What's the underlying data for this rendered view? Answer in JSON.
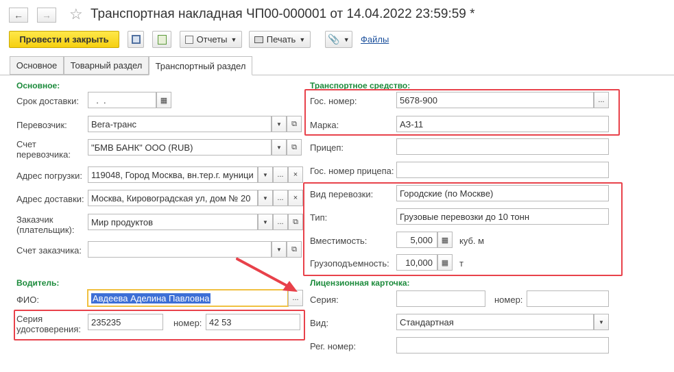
{
  "header": {
    "title": "Транспортная накладная ЧП00-000001 от 14.04.2022 23:59:59 *"
  },
  "toolbar": {
    "post_close": "Провести и закрыть",
    "reports": "Отчеты",
    "print": "Печать",
    "files": "Файлы"
  },
  "tabs": [
    "Основное",
    "Товарный раздел",
    "Транспортный раздел"
  ],
  "left": {
    "section_main": "Основное:",
    "delivery_label": "Срок доставки:",
    "delivery_value": "  .  .",
    "carrier_label": "Перевозчик:",
    "carrier_value": "Вега-транс",
    "carrier_acc_label": "Счет перевозчика:",
    "carrier_acc_value": "\"БМВ БАНК\" ООО (RUB)",
    "load_label": "Адрес погрузки:",
    "load_value": "119048, Город Москва, вн.тер.г. муници",
    "deliv_addr_label": "Адрес доставки:",
    "deliv_addr_value": "Москва, Кировоградская ул, дом № 20",
    "customer_label": "Заказчик (плательщик):",
    "customer_value": "Мир продуктов",
    "customer_acc_label": "Счет заказчика:",
    "customer_acc_value": "",
    "section_driver": "Водитель:",
    "fio_label": "ФИО:",
    "fio_value": "Авдеева Аделина Павловна",
    "series_label": "Серия удостоверения:",
    "series_value": "235235",
    "number_label": "номер:",
    "number_value": "42 53"
  },
  "right": {
    "section_vehicle": "Транспортное средство:",
    "plate_label": "Гос. номер:",
    "plate_value": "5678-900",
    "brand_label": "Марка:",
    "brand_value": "АЗ-11",
    "trailer_label": "Прицеп:",
    "trailer_value": "",
    "trailer_plate_label": "Гос. номер прицепа:",
    "trailer_plate_value": "",
    "transport_kind_label": "Вид перевозки:",
    "transport_kind_value": "Городские (по Москве)",
    "type_label": "Тип:",
    "type_value": "Грузовые перевозки до 10 тонн",
    "capacity_label": "Вместимость:",
    "capacity_value": "5,000",
    "capacity_unit": "куб. м",
    "load_cap_label": "Грузоподъемность:",
    "load_cap_value": "10,000",
    "load_cap_unit": "т",
    "section_license": "Лицензионная карточка:",
    "lic_series_label": "Серия:",
    "lic_series_value": "",
    "lic_number_label": "номер:",
    "lic_number_value": "",
    "lic_kind_label": "Вид:",
    "lic_kind_value": "Стандартная",
    "reg_label": "Рег. номер:",
    "reg_value": ""
  },
  "colors": {
    "accent_green": "#1a8a3a",
    "highlight_red": "#e8414a",
    "primary_yellow": "#f5cf10",
    "selection_blue": "#3d6fd6"
  }
}
